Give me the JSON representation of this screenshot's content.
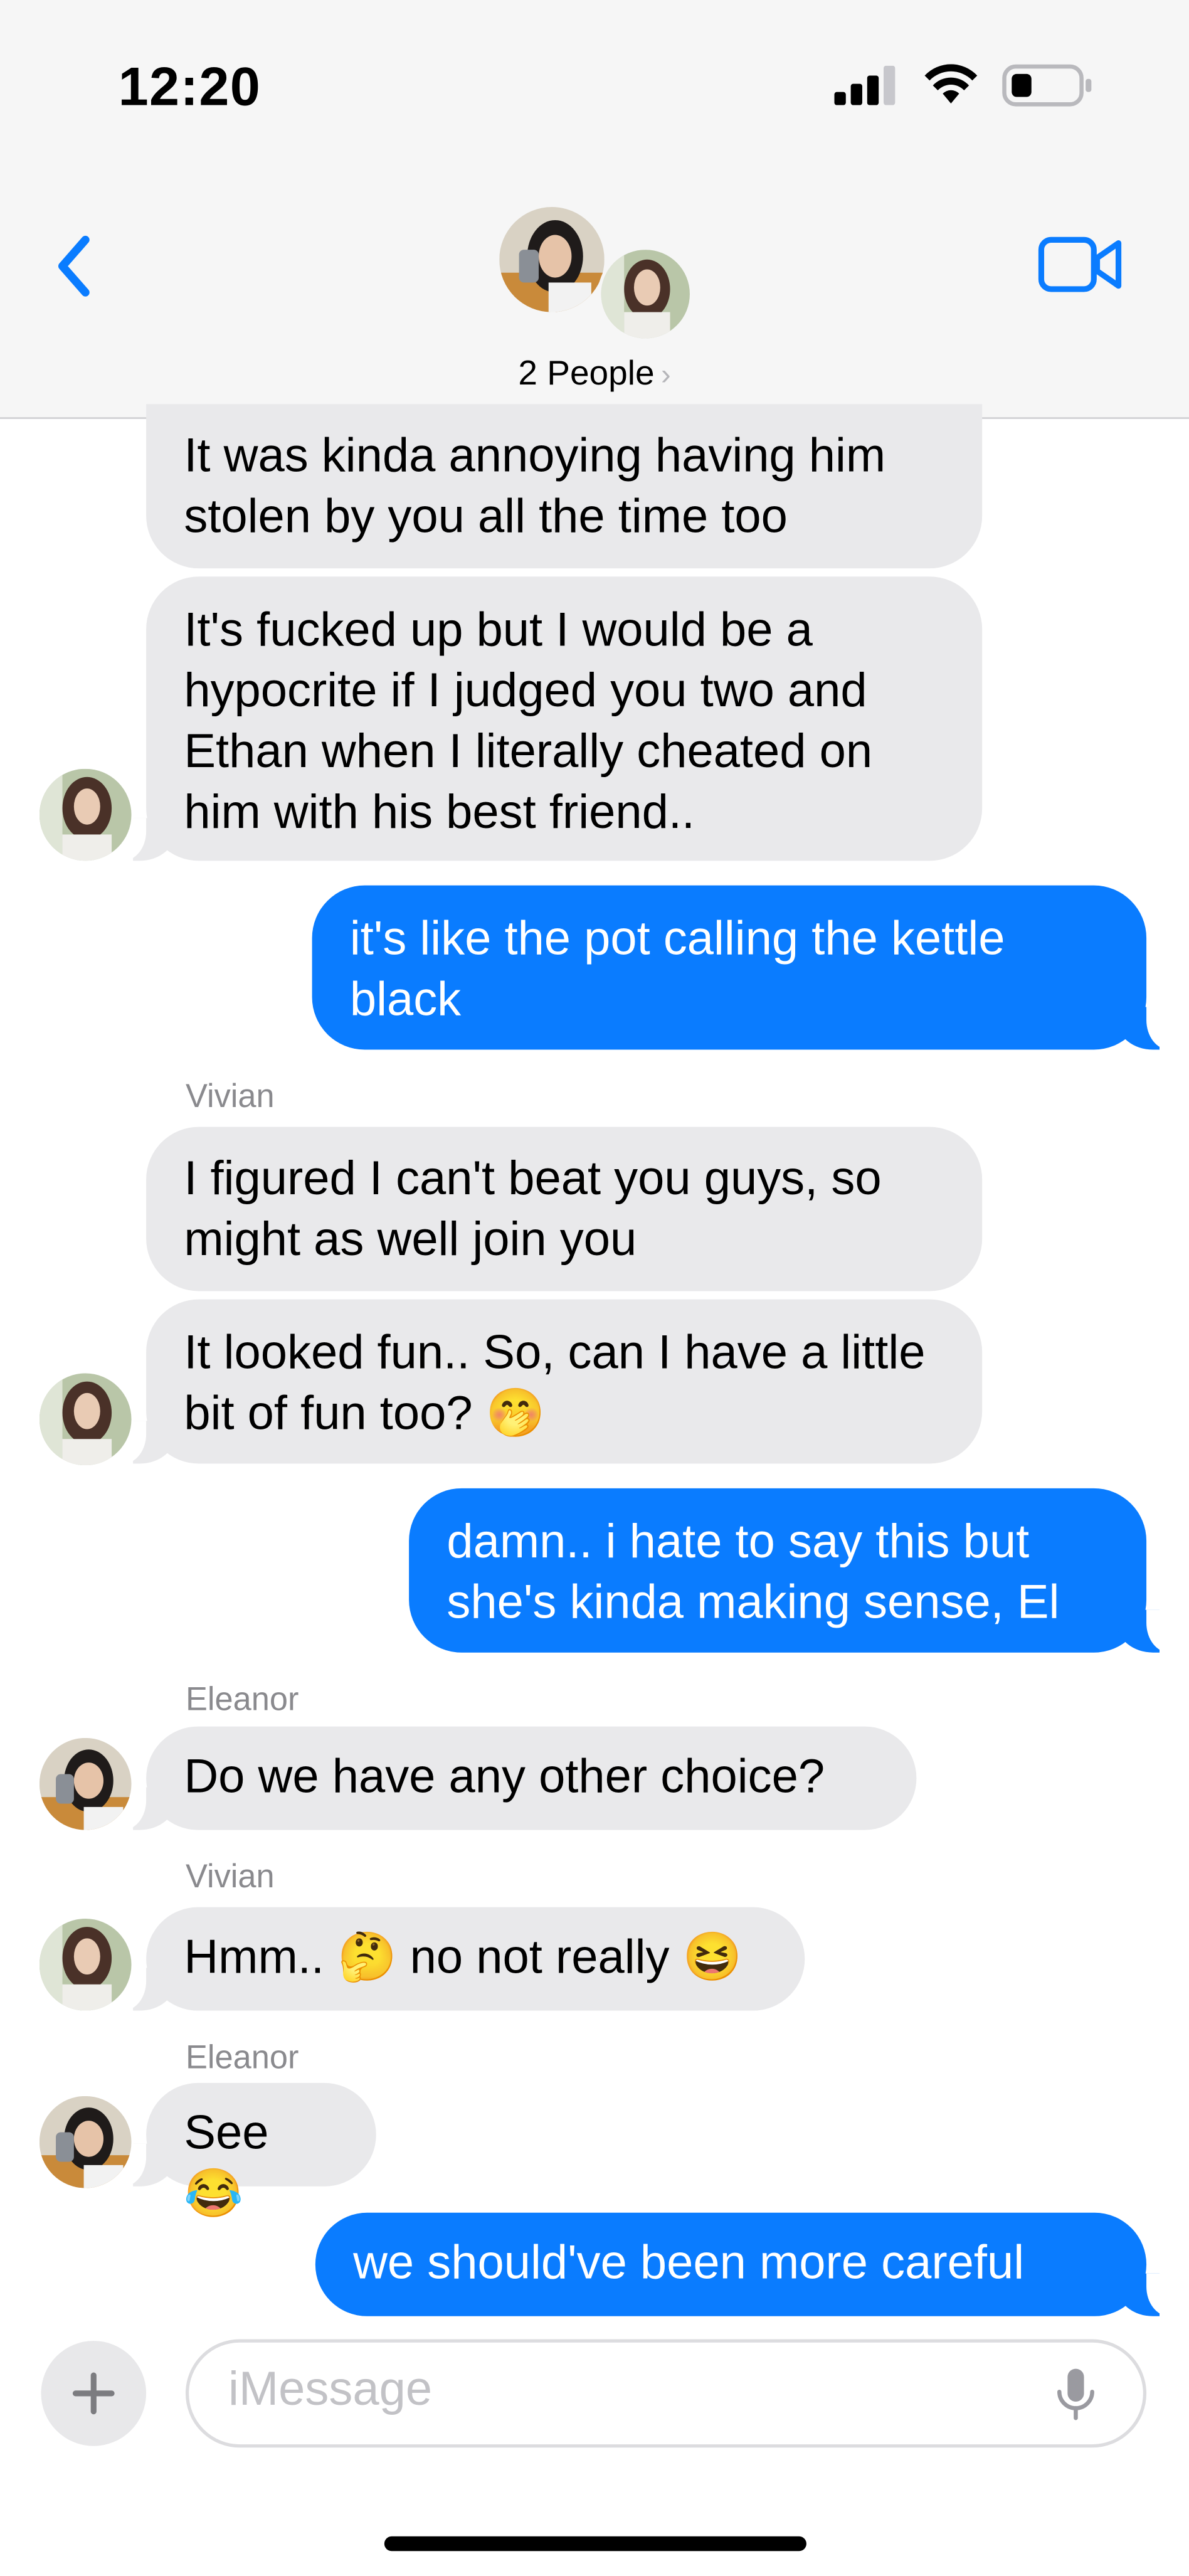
{
  "status_bar": {
    "time": "12:20"
  },
  "header": {
    "group_name": "2 People"
  },
  "messages": [
    {
      "text": "It was kinda annoying having him stolen by you all the time too"
    },
    {
      "text": "It's fucked up but I would be a hypocrite if I judged you two and Ethan when I literally cheated on him with his best friend.."
    },
    {
      "text": "it's like the pot calling the kettle black"
    },
    {
      "sender": "Vivian",
      "text": "I figured I can't beat you guys, so might as well join you"
    },
    {
      "text": "It looked fun.. So, can I have a little bit of fun too? 🤭"
    },
    {
      "text": "damn.. i hate to say this but she's kinda making sense, El"
    },
    {
      "sender": "Eleanor",
      "text": "Do we have any other choice?"
    },
    {
      "sender": "Vivian",
      "text": "Hmm.. 🤔 no not really 😆"
    },
    {
      "sender": "Eleanor",
      "text": "See 😂"
    },
    {
      "text": "we should've been more careful"
    }
  ],
  "input": {
    "placeholder": "iMessage"
  },
  "colors": {
    "sent_bubble": "#0a7cff",
    "received_bubble": "#e9e9eb",
    "accent": "#0a7cff"
  },
  "icons": [
    "back-chevron-icon",
    "video-camera-icon",
    "plus-icon",
    "microphone-icon",
    "cellular-signal-icon",
    "wifi-icon",
    "battery-icon"
  ]
}
